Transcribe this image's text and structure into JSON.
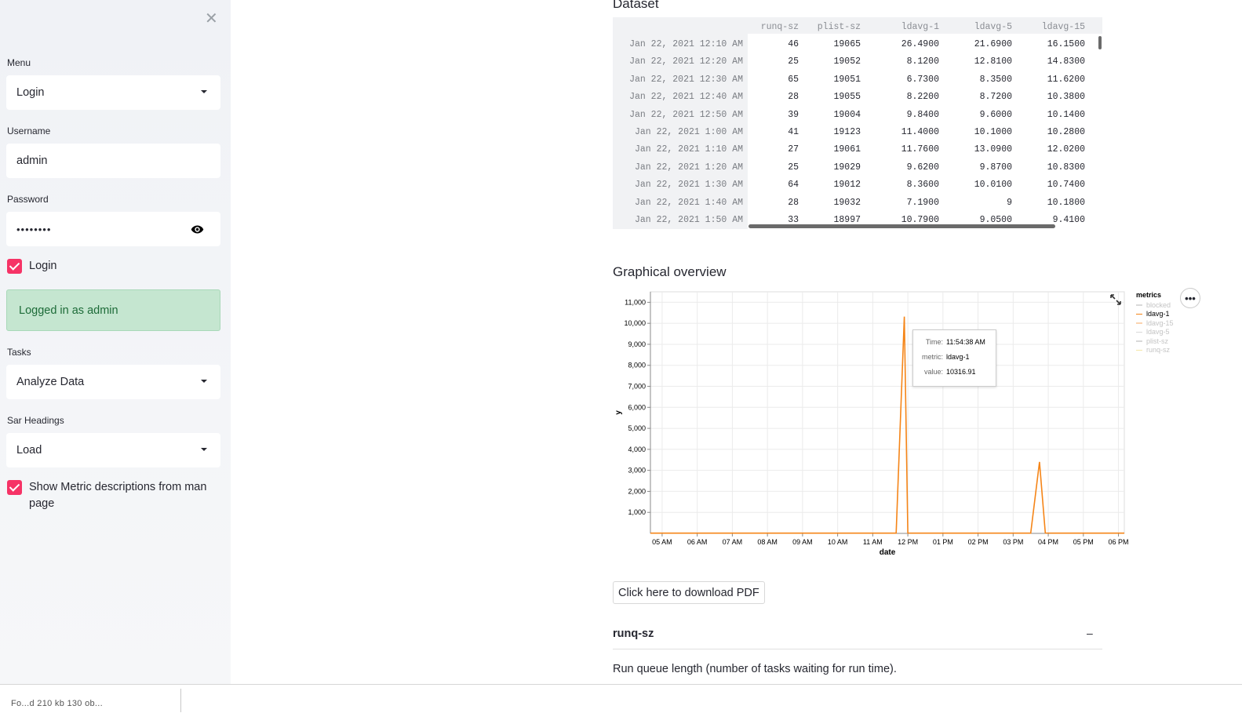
{
  "sidebar": {
    "close_icon": "close-icon",
    "menu": {
      "label": "Menu",
      "value": "Login"
    },
    "username": {
      "label": "Username",
      "value": "admin"
    },
    "password": {
      "label": "Password",
      "value": "••••••••",
      "toggle_icon": "eye-icon"
    },
    "login_checkbox": {
      "label": "Login",
      "checked": true
    },
    "success_message": "Logged in as admin",
    "tasks": {
      "label": "Tasks",
      "value": "Analyze Data"
    },
    "sar_headings": {
      "label": "Sar Headings",
      "value": "Load"
    },
    "metric_checkbox": {
      "label": "Show Metric descriptions from man page",
      "checked": true
    },
    "accent_color": "#f63366"
  },
  "dataset": {
    "title": "Dataset",
    "columns": [
      "runq-sz",
      "plist-sz",
      "ldavg-1",
      "ldavg-5",
      "ldavg-15"
    ],
    "rows": [
      {
        "index": "Jan 22, 2021 12:10 AM",
        "cells": [
          "46",
          "19065",
          "26.4900",
          "21.6900",
          "16.1500"
        ]
      },
      {
        "index": "Jan 22, 2021 12:20 AM",
        "cells": [
          "25",
          "19052",
          "8.1200",
          "12.8100",
          "14.8300"
        ]
      },
      {
        "index": "Jan 22, 2021 12:30 AM",
        "cells": [
          "65",
          "19051",
          "6.7300",
          "8.3500",
          "11.6200"
        ]
      },
      {
        "index": "Jan 22, 2021 12:40 AM",
        "cells": [
          "28",
          "19055",
          "8.2200",
          "8.7200",
          "10.3800"
        ]
      },
      {
        "index": "Jan 22, 2021 12:50 AM",
        "cells": [
          "39",
          "19004",
          "9.8400",
          "9.6000",
          "10.1400"
        ]
      },
      {
        "index": "Jan 22, 2021 1:00 AM",
        "cells": [
          "41",
          "19123",
          "11.4000",
          "10.1000",
          "10.2800"
        ]
      },
      {
        "index": "Jan 22, 2021 1:10 AM",
        "cells": [
          "27",
          "19061",
          "11.7600",
          "13.0900",
          "12.0200"
        ]
      },
      {
        "index": "Jan 22, 2021 1:20 AM",
        "cells": [
          "25",
          "19029",
          "9.6200",
          "9.8700",
          "10.8300"
        ]
      },
      {
        "index": "Jan 22, 2021 1:30 AM",
        "cells": [
          "64",
          "19012",
          "8.3600",
          "10.0100",
          "10.7400"
        ]
      },
      {
        "index": "Jan 22, 2021 1:40 AM",
        "cells": [
          "28",
          "19032",
          "7.1900",
          "9",
          "10.1800"
        ]
      },
      {
        "index": "Jan 22, 2021 1:50 AM",
        "cells": [
          "33",
          "18997",
          "10.7900",
          "9.0500",
          "9.4100"
        ]
      }
    ]
  },
  "graph": {
    "title": "Graphical overview",
    "expand_icon": "expand-icon",
    "more_icon": "more-icon",
    "more_label": "•••",
    "legend_title": "metrics",
    "legend": [
      {
        "name": "blocked",
        "color": "#d9d9d9",
        "active": false
      },
      {
        "name": "ldavg-1",
        "color": "#f58518",
        "active": true
      },
      {
        "name": "ldavg-15",
        "color": "#fbd3b0",
        "active": false
      },
      {
        "name": "ldavg-5",
        "color": "#d9d9d9",
        "active": false
      },
      {
        "name": "plist-sz",
        "color": "#d9d9d9",
        "active": false
      },
      {
        "name": "runq-sz",
        "color": "#f4e6a6",
        "active": false
      }
    ],
    "tooltip": {
      "time_label": "Time:",
      "time": "11:54:38 AM",
      "metric_label": "metric:",
      "metric": "ldavg-1",
      "value_label": "value:",
      "value": "10316.91"
    }
  },
  "chart_data": {
    "type": "line",
    "xlabel": "date",
    "ylabel": "y",
    "ylim": [
      0,
      11500
    ],
    "yticks": [
      1000,
      2000,
      3000,
      4000,
      5000,
      6000,
      7000,
      8000,
      9000,
      10000,
      11000
    ],
    "ytick_labels": [
      "1,000",
      "2,000",
      "3,000",
      "4,000",
      "5,000",
      "6,000",
      "7,000",
      "8,000",
      "9,000",
      "10,000",
      "11,000"
    ],
    "xlim": [
      "04:40",
      "18:10"
    ],
    "xtick_labels": [
      "05 AM",
      "06 AM",
      "07 AM",
      "08 AM",
      "09 AM",
      "10 AM",
      "11 AM",
      "12 PM",
      "01 PM",
      "02 PM",
      "03 PM",
      "04 PM",
      "05 PM",
      "06 PM"
    ],
    "grid": true,
    "legend_position": "right",
    "series": [
      {
        "name": "ldavg-1",
        "color": "#f58518",
        "x": [
          "04:40",
          "11:40",
          "11:54",
          "12:00",
          "12:10",
          "15:30",
          "15:45",
          "15:55",
          "16:10",
          "18:10"
        ],
        "y": [
          10,
          12,
          10317,
          15,
          10,
          12,
          3400,
          20,
          10,
          10
        ]
      }
    ]
  },
  "download_button": "Click here to download PDF",
  "expander": {
    "title": "runq-sz",
    "toggle": "–",
    "description": "Run queue length (number of tasks waiting for run time)."
  },
  "footer": {
    "text": "Fo...d 210 kb 130 ob..."
  }
}
